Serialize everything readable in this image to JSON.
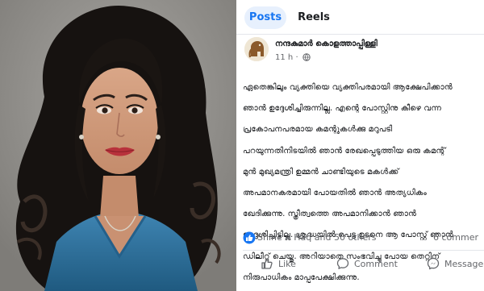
{
  "tabs": [
    {
      "label": "Posts",
      "active": true
    },
    {
      "label": "Reels",
      "active": false
    }
  ],
  "post": {
    "author": "നന്ദകുമാർ കൊളത്താപ്പിള്ളി",
    "time": "11 h",
    "separator": "·",
    "body_lines": [
      "ഏതെങ്കിലും വ്യക്തിയെ വ്യക്തിപരമായി ആക്ഷേപിക്കാൻ",
      "ഞാൻ ഉദ്ദേശിച്ചിരുന്നില്ല. എന്റെ പോസ്റ്റിനു കീഴെ വന്ന",
      "പ്രകോപനപരമായ കമന്റുകൾക്കു മറുപടി",
      "പറയുന്നതിനിടയിൽ ഞാൻ രേഖപ്പെടുത്തിയ ഒരു കമന്റ്",
      "മുൻ മുഖ്യമന്ത്രി ഉമ്മൻ ചാണ്ടിയുടെ മകൾക്ക്",
      "അപമാനകരമായി പോയതിൽ ഞാൻ അത്യധികം",
      "ഖേദിക്കുന്നു. സ്ത്രീത്വത്തെ അപമാനിക്കാൻ ഞാൻ",
      "ഉദ്ദേശിച്ചിട്ടില്ല. ശ്രദ്ധയിൽ പെട്ട ഉടനെ ആ പോസ്റ്റ് ഞാൻ",
      "ഡിലീറ്റ് ചെയ്തു. അറിയാതെ സംഭവിച്ചു പോയ തെറ്റിന്",
      "നിരുപാധികം മാപ്പപേക്ഷിക്കുന്നു."
    ],
    "reactions_text": "Shine A Haq and 50 others",
    "comments_text": "6 commer"
  },
  "actions": {
    "like": "Like",
    "comment": "Comment",
    "message": "Message"
  },
  "colors": {
    "facebook_blue": "#1876f2",
    "tab_active_bg": "#e7f0fd",
    "text_primary": "#1c1e21",
    "text_secondary": "#65676b",
    "photo_background": "#8d8b88",
    "dress_teal": "#2f6f9a"
  },
  "icons": {
    "reaction": "like-reaction-icon",
    "like": "thumbs-up-icon",
    "comment": "comment-bubble-icon",
    "message": "messenger-icon",
    "privacy": "globe-icon"
  }
}
